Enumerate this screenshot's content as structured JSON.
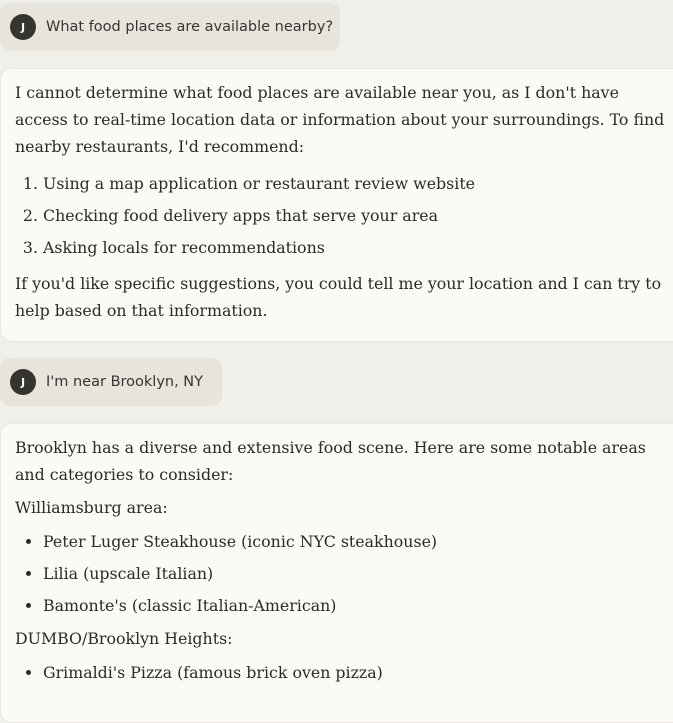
{
  "conversation": {
    "messages": [
      {
        "role": "user",
        "avatar_initial": "J",
        "text": "What food places are available nearby?"
      },
      {
        "role": "assistant",
        "intro": "I cannot determine what food places are available near you, as I don't have access to real-time location data or information about your surroundings. To find nearby restaurants, I'd recommend:",
        "list": [
          "Using a map application or restaurant review website",
          "Checking food delivery apps that serve your area",
          "Asking locals for recommendations"
        ],
        "outro": "If you'd like specific suggestions, you could tell me your location and I can try to help based on that information."
      },
      {
        "role": "user",
        "avatar_initial": "J",
        "text": "I'm near Brooklyn, NY"
      },
      {
        "role": "assistant",
        "intro": "Brooklyn has a diverse and extensive food scene. Here are some notable areas and categories to consider:",
        "sections": [
          {
            "heading": "Williamsburg area:",
            "items": [
              "Peter Luger Steakhouse (iconic NYC steakhouse)",
              "Lilia (upscale Italian)",
              "Bamonte's (classic Italian-American)"
            ]
          },
          {
            "heading": "DUMBO/Brooklyn Heights:",
            "items": [
              "Grimaldi's Pizza (famous brick oven pizza)"
            ]
          }
        ]
      }
    ]
  }
}
